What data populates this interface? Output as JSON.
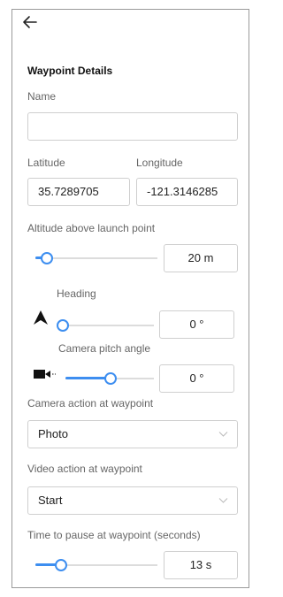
{
  "header": {
    "title": "Waypoint Details"
  },
  "fields": {
    "name": {
      "label": "Name",
      "value": ""
    },
    "latitude": {
      "label": "Latitude",
      "value": "35.7289705"
    },
    "longitude": {
      "label": "Longitude",
      "value": "-121.3146285"
    },
    "altitude": {
      "label": "Altitude above launch point",
      "value": "20 m",
      "slider_fraction": 0.1
    },
    "heading": {
      "label": "Heading",
      "value": "0 °",
      "slider_fraction": 0.0
    },
    "camera_pitch": {
      "label": "Camera pitch angle",
      "value": "0 °",
      "slider_fraction": 0.5
    },
    "camera_action": {
      "label": "Camera action at waypoint",
      "selected": "Photo"
    },
    "video_action": {
      "label": "Video action at waypoint",
      "selected": "Start"
    },
    "pause_time": {
      "label": "Time to pause at waypoint (seconds)",
      "value": "13 s",
      "slider_fraction": 0.2
    }
  },
  "colors": {
    "accent": "#3d8ef0",
    "border": "#cfcfcf",
    "label": "#666666"
  },
  "icons": [
    "back-arrow-icon",
    "heading-arrow-icon",
    "camera-icon",
    "chevron-down-icon"
  ]
}
